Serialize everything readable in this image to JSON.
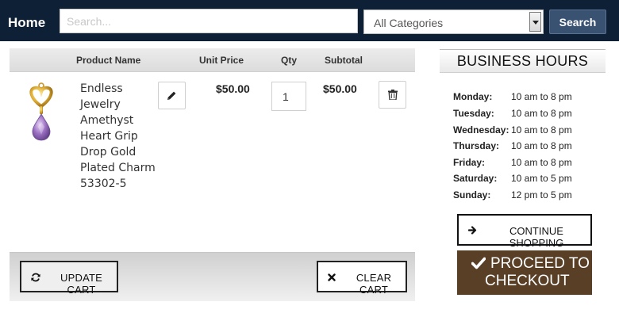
{
  "header": {
    "home": "Home",
    "search_placeholder": "Search...",
    "category": "All Categories",
    "search_button": "Search"
  },
  "cart": {
    "columns": {
      "name": "Product Name",
      "price": "Unit Price",
      "qty": "Qty",
      "subtotal": "Subtotal"
    },
    "item": {
      "name_lines": [
        "Endless",
        "Jewelry",
        "Amethyst",
        "Heart Grip",
        "Drop Gold",
        "Plated Charm",
        "53302-5"
      ],
      "unit_price": "$50.00",
      "qty": "1",
      "subtotal": "$50.00"
    },
    "update_label": "UPDATE CART",
    "clear_label": "CLEAR CART"
  },
  "sidebar": {
    "title": "BUSINESS HOURS",
    "hours": [
      {
        "day": "Monday:",
        "time": "10 am to 8 pm"
      },
      {
        "day": "Tuesday:",
        "time": "10 am to 8 pm"
      },
      {
        "day": "Wednesday:",
        "time": "10 am to 8 pm"
      },
      {
        "day": "Thursday:",
        "time": "10 am to 8 pm"
      },
      {
        "day": "Friday:",
        "time": "10 am to 8 pm"
      },
      {
        "day": "Saturday:",
        "time": "10 am to 5 pm"
      },
      {
        "day": "Sunday:",
        "time": "12 pm to 5 pm"
      }
    ],
    "continue_label": "CONTINUE SHOPPING",
    "checkout_line1": "PROCEED TO",
    "checkout_line2": "CHECKOUT"
  },
  "colors": {
    "topbar": "#0e2036",
    "search_button": "#3a5272",
    "checkout": "#5a3f27"
  },
  "icons": {
    "edit": "pencil-icon",
    "delete": "trash-icon",
    "update": "refresh-icon",
    "clear": "close-icon",
    "continue": "arrow-right-icon",
    "checkout": "checkmark-icon"
  }
}
